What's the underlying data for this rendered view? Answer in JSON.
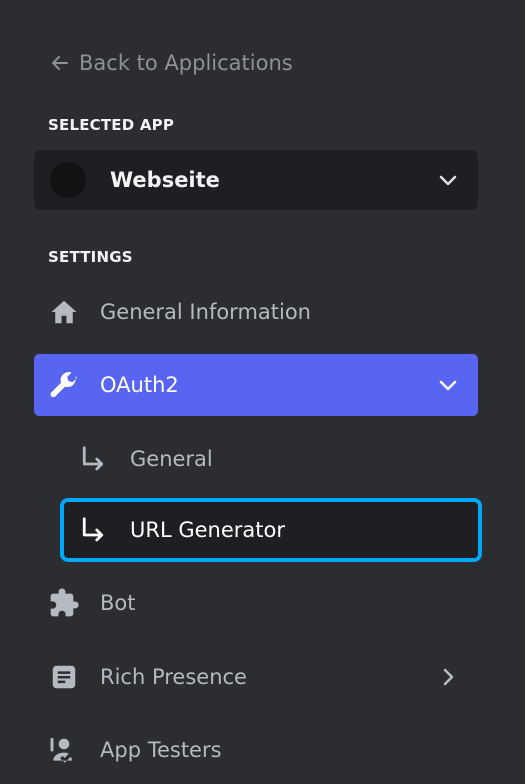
{
  "back_link": {
    "label": "Back to Applications"
  },
  "selected_app": {
    "section_label": "SELECTED APP",
    "app_name": "Webseite"
  },
  "settings": {
    "section_label": "SETTINGS",
    "items": [
      {
        "label": "General Information",
        "icon": "home-icon"
      },
      {
        "label": "OAuth2",
        "icon": "wrench-icon",
        "active": true,
        "expanded": true,
        "children": [
          {
            "label": "General",
            "icon": "subitem-arrow-icon"
          },
          {
            "label": "URL Generator",
            "icon": "subitem-arrow-icon",
            "selected": true
          }
        ]
      },
      {
        "label": "Bot",
        "icon": "puzzle-icon"
      },
      {
        "label": "Rich Presence",
        "icon": "document-icon",
        "has_chevron": true
      },
      {
        "label": "App Testers",
        "icon": "user-check-icon"
      }
    ]
  },
  "colors": {
    "background": "#2b2d31",
    "active_item": "#5865f2",
    "selected_outline": "#00a8fc",
    "muted_text": "#b5bac1"
  }
}
